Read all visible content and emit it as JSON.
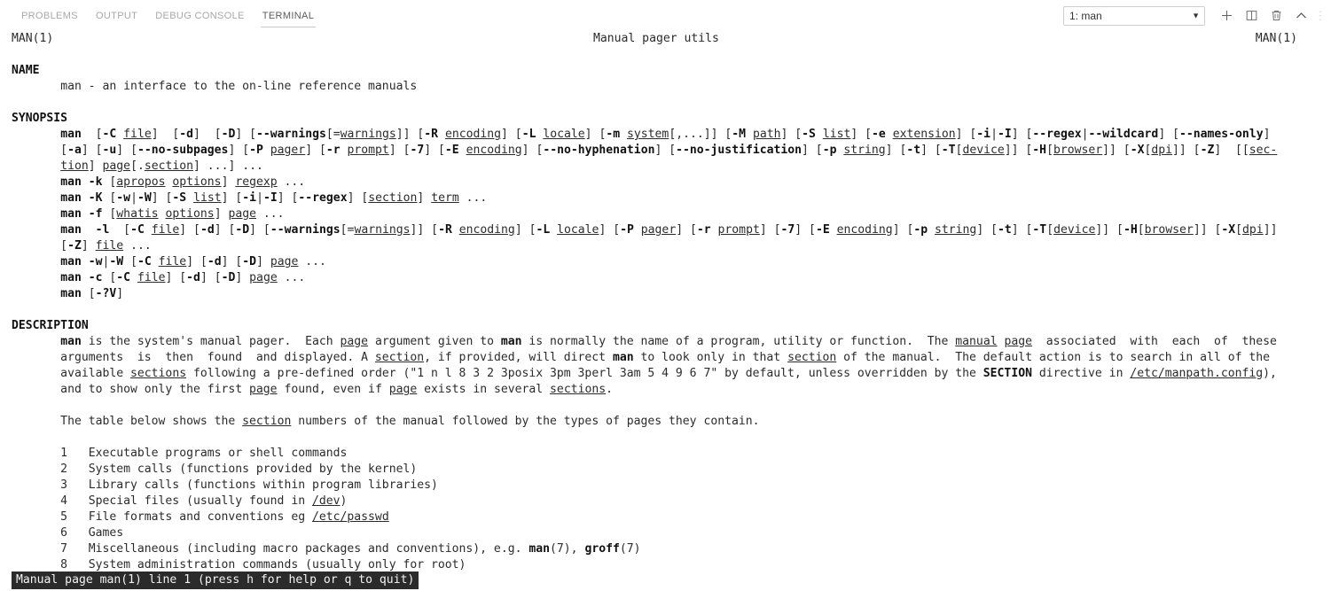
{
  "panel": {
    "tabs": [
      {
        "id": "problems",
        "label": "PROBLEMS",
        "active": false
      },
      {
        "id": "output",
        "label": "OUTPUT",
        "active": false
      },
      {
        "id": "debug-console",
        "label": "DEBUG CONSOLE",
        "active": false
      },
      {
        "id": "terminal",
        "label": "TERMINAL",
        "active": true
      }
    ],
    "terminal_select": {
      "value": "1: man",
      "caret": "▼"
    },
    "actions": [
      {
        "id": "new-terminal",
        "name": "add-icon",
        "title": "New Terminal"
      },
      {
        "id": "split-terminal",
        "name": "split-editor-icon",
        "title": "Split Terminal"
      },
      {
        "id": "kill-terminal",
        "name": "trash-icon",
        "title": "Kill Terminal"
      },
      {
        "id": "maximize-panel",
        "name": "chevron-up-icon",
        "title": "Maximize Panel Size"
      },
      {
        "id": "more-actions",
        "name": "kebab-menu-icon",
        "title": "Views and More Actions",
        "glyph": "⋮"
      }
    ]
  },
  "man": {
    "header": {
      "left": "MAN(1)",
      "center": "Manual pager utils",
      "right": "MAN(1)"
    },
    "sections": {
      "name_heading": "NAME",
      "name_body": "man - an interface to the on-line reference manuals",
      "synopsis_heading": "SYNOPSIS",
      "description_heading": "DESCRIPTION"
    },
    "synopsis_lines": [
      "man  [-C file]  [-d]  [-D] [--warnings[=warnings]] [-R encoding] [-L locale] [-m system[,...]] [-M path] [-S list] [-e extension] [-i|-I] [--regex|--wildcard] [--names-only]",
      "[-a] [-u] [--no-subpages] [-P pager] [-r prompt] [-7] [-E encoding] [--no-hyphenation] [--no-justification] [-p string] [-t] [-T[device]] [-H[browser]] [-X[dpi]] [-Z]  [[sec-",
      "tion] page[.section] ...] ...",
      "man -k [apropos options] regexp ...",
      "man -K [-w|-W] [-S list] [-i|-I] [--regex] [section] term ...",
      "man -f [whatis options] page ...",
      "man  -l  [-C file] [-d] [-D] [--warnings[=warnings]] [-R encoding] [-L locale] [-P pager] [-r prompt] [-7] [-E encoding] [-p string] [-t] [-T[device]] [-H[browser]] [-X[dpi]]",
      "[-Z] file ...",
      "man -w|-W [-C file] [-d] [-D] page ...",
      "man -c [-C file] [-d] [-D] page ...",
      "man [-?V]"
    ],
    "description_lines": [
      "man is the system's manual pager.  Each page argument given to man is normally the name of a program, utility or function.  The manual page  associated  with  each  of  these",
      "arguments  is  then  found  and displayed. A section, if provided, will direct man to look only in that section of the manual.  The default action is to search in all of the",
      "available sections following a pre-defined order (\"1 n l 8 3 2 3posix 3pm 3perl 3am 5 4 9 6 7\" by default, unless overridden by the SECTION directive in /etc/manpath.config),",
      "and to show only the first page found, even if page exists in several sections."
    ],
    "table_intro": "The table below shows the section numbers of the manual followed by the types of pages they contain.",
    "section_table": [
      {
        "num": "1",
        "desc": "Executable programs or shell commands"
      },
      {
        "num": "2",
        "desc": "System calls (functions provided by the kernel)"
      },
      {
        "num": "3",
        "desc": "Library calls (functions within program libraries)"
      },
      {
        "num": "4",
        "desc": "Special files (usually found in /dev)"
      },
      {
        "num": "5",
        "desc": "File formats and conventions eg /etc/passwd"
      },
      {
        "num": "6",
        "desc": "Games"
      },
      {
        "num": "7",
        "desc": "Miscellaneous (including macro packages and conventions), e.g. man(7), groff(7)"
      },
      {
        "num": "8",
        "desc": "System administration commands (usually only for root)"
      }
    ],
    "status_line": "Manual page man(1) line 1 (press h for help or q to quit)"
  },
  "colors": {
    "background": "#ffffff",
    "foreground": "#2b2b2b",
    "tab_inactive": "#a8a8a8",
    "tab_active": "#5c5c5c",
    "status_bg": "#2b2b2b",
    "status_fg": "#f2f2f2",
    "select_border": "#cecece"
  }
}
